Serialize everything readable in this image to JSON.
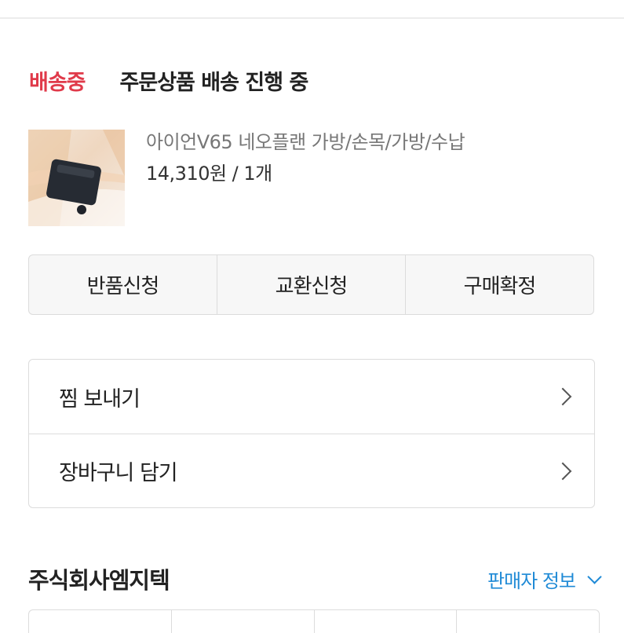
{
  "order": {
    "status_badge": "배송중",
    "status_text": "주문상품 배송 진행 중",
    "status_color": "#e03a4a"
  },
  "product": {
    "name": "아이언V65 네오플랜 가방/손목/가방/수납",
    "price_qty": "14,310원 / 1개",
    "thumbnail_icon": "product-photo"
  },
  "actions": {
    "return_label": "반품신청",
    "exchange_label": "교환신청",
    "confirm_label": "구매확정"
  },
  "menu": {
    "items": [
      {
        "label": "찜 보내기",
        "icon": "chevron-right-icon"
      },
      {
        "label": "장바구니 담기",
        "icon": "chevron-right-icon"
      }
    ]
  },
  "seller": {
    "name": "주식회사엠지텍",
    "info_label": "판매자 정보",
    "info_icon": "chevron-down-icon",
    "link_color": "#1f8ad6"
  }
}
